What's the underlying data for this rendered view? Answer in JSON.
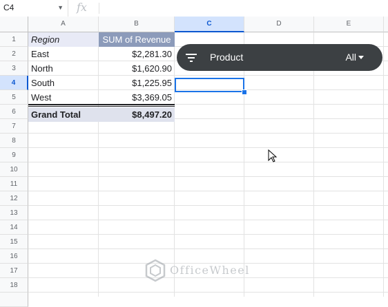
{
  "formula_bar": {
    "name_box": "C4",
    "fx_label": "fx"
  },
  "columns": [
    "A",
    "B",
    "C",
    "D",
    "E"
  ],
  "rows": [
    "1",
    "2",
    "3",
    "4",
    "5",
    "6",
    "7",
    "8",
    "9",
    "10",
    "11",
    "12",
    "13",
    "14",
    "15",
    "16",
    "17",
    "18"
  ],
  "selected_cell": "C4",
  "pivot": {
    "header_region": "Region",
    "header_sum": "SUM of Revenue",
    "rows": [
      {
        "region": "East",
        "value": "$2,281.30"
      },
      {
        "region": "North",
        "value": "$1,620.90"
      },
      {
        "region": "South",
        "value": "$1,225.95"
      },
      {
        "region": "West",
        "value": "$3,369.05"
      }
    ],
    "total_label": "Grand Total",
    "total_value": "$8,497.20"
  },
  "filter_chip": {
    "label": "Product",
    "value": "All",
    "icon": "filter-icon"
  },
  "watermark": {
    "text": "OfficeWheel"
  },
  "colors": {
    "selection": "#1a73e8",
    "chip_bg": "#3c4043",
    "pivot_header": "#8c9bba",
    "pivot_total": "#dfe2ed"
  }
}
